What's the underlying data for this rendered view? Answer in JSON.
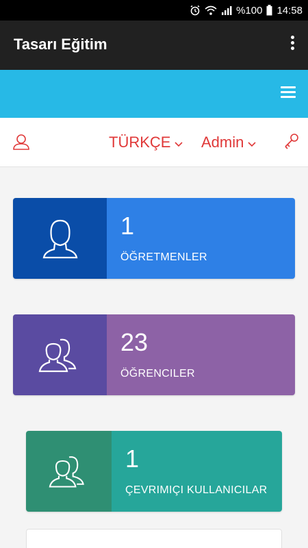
{
  "status_bar": {
    "battery_text": "%100",
    "time": "14:58",
    "icons": [
      "alarm-icon",
      "wifi-icon",
      "signal-icon",
      "battery-icon"
    ]
  },
  "app_bar": {
    "title": "Tasarı Eğitim",
    "menu_icon": "overflow-menu-icon"
  },
  "top_nav": {
    "menu_icon": "hamburger-icon",
    "user_icon": "user-icon",
    "language": "TÜRKÇE",
    "user_menu": "Admin",
    "key_icon": "key-icon"
  },
  "stats": [
    {
      "value": "1",
      "label": "ÖĞRETMENLER",
      "icon": "teacher-icon"
    },
    {
      "value": "23",
      "label": "ÖĞRENCILER",
      "icon": "students-icon"
    },
    {
      "value": "1",
      "label": "ÇEVRIMIÇI KULLANICILAR",
      "icon": "online-users-icon"
    }
  ],
  "colors": {
    "app_bar": "#212121",
    "header_accent": "#27b9e6",
    "nav_red": "#e03838",
    "teachers_dark": "#0a4da8",
    "teachers_light": "#2e80e6",
    "students_dark": "#5a4ba1",
    "students_light": "#8d62a6",
    "online_dark": "#2f8f73",
    "online_light": "#26a69a"
  }
}
